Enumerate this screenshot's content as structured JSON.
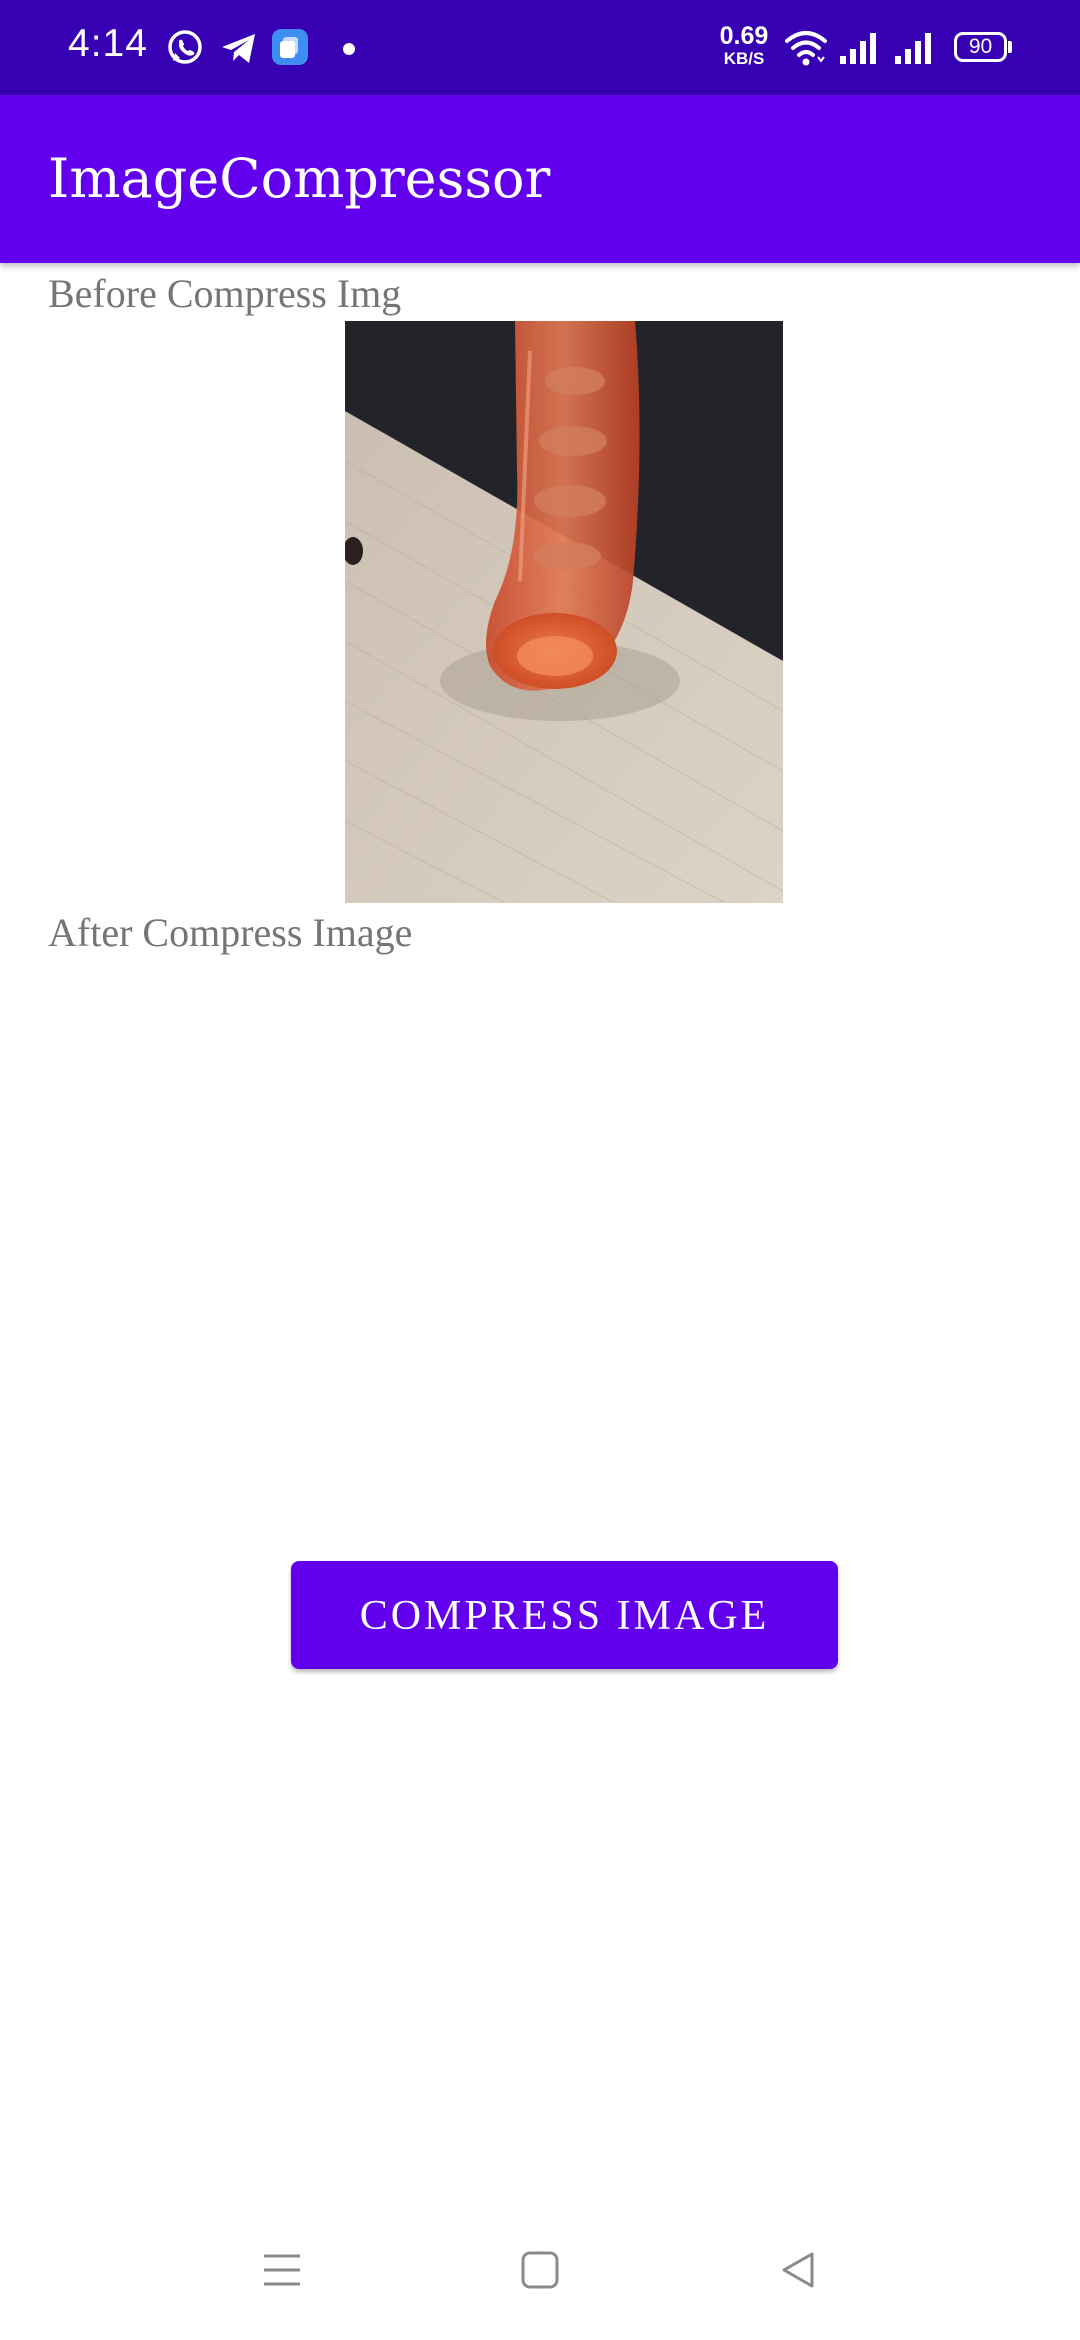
{
  "status_bar": {
    "time": "4:14",
    "net_speed_value": "0.69",
    "net_speed_unit": "KB/S",
    "battery_level": "90",
    "icons": [
      "whatsapp-icon",
      "telegram-icon",
      "app-notification-icon",
      "dot-icon",
      "wifi-icon",
      "signal-icon",
      "signal-icon",
      "battery-icon"
    ]
  },
  "app_bar": {
    "title": "ImageCompressor"
  },
  "main": {
    "before_label": "Before Compress Img",
    "after_label": "After Compress Image",
    "compress_button_label": "COMPRESS IMAGE"
  },
  "nav_bar": {
    "icons": [
      "menu-icon",
      "home-icon",
      "back-icon"
    ]
  },
  "colors": {
    "status_bar": "#3700b3",
    "primary": "#6200ee",
    "label_text": "#757575"
  }
}
